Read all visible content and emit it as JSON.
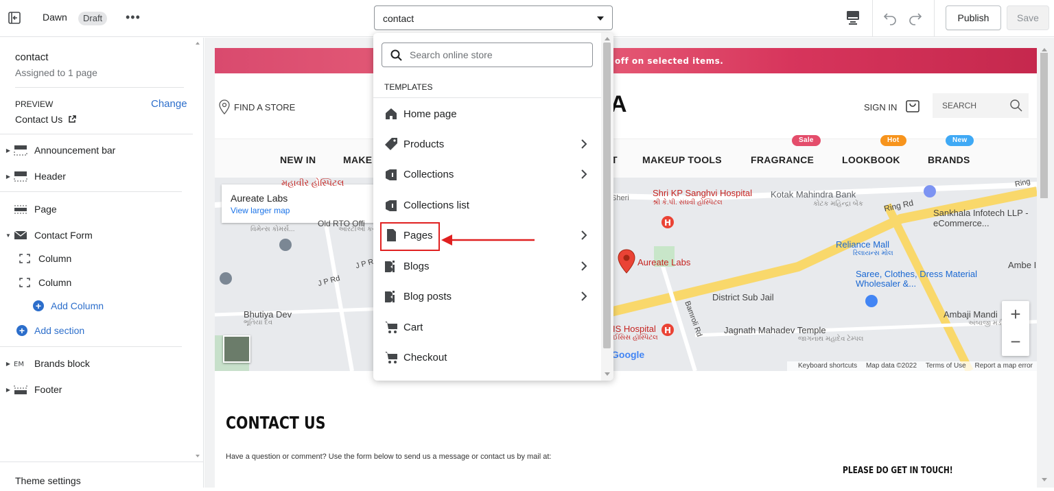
{
  "topbar": {
    "theme_name": "Dawn",
    "draft_label": "Draft",
    "more_label": "•••",
    "template_value": "contact",
    "publish_label": "Publish",
    "save_label": "Save"
  },
  "sidebar": {
    "title": "contact",
    "subtitle": "Assigned to 1 page",
    "preview_label": "PREVIEW",
    "change_label": "Change",
    "preview_value": "Contact Us",
    "sections": [
      {
        "label": "Announcement bar",
        "icon": "announcement-bar-icon"
      },
      {
        "label": "Header",
        "icon": "header-icon"
      },
      {
        "label": "Page",
        "icon": "page-icon"
      },
      {
        "label": "Contact Form",
        "icon": "mail-icon"
      },
      {
        "label": "Column",
        "icon": "column-icon"
      },
      {
        "label": "Column",
        "icon": "column-icon"
      },
      {
        "label": "Add Column",
        "icon": "plus-circle-icon"
      },
      {
        "label": "Add section",
        "icon": "plus-circle-icon"
      },
      {
        "label": "Brands block",
        "icon": "brands-block-icon"
      },
      {
        "label": "Footer",
        "icon": "footer-icon"
      }
    ],
    "theme_settings": "Theme settings"
  },
  "preview": {
    "announcement": "off on selected items.",
    "find_store": "FIND A STORE",
    "logo_fragment": "A",
    "sign_in": "SIGN IN",
    "search": "SEARCH",
    "nav": [
      {
        "label": "NEW IN"
      },
      {
        "label": "MAKE"
      },
      {
        "label": "T"
      },
      {
        "label": "MAKEUP TOOLS"
      },
      {
        "label": "FRAGRANCE",
        "badge": "Sale",
        "badge_color": "#e44d6b"
      },
      {
        "label": "LOOKBOOK",
        "badge": "Hot",
        "badge_color": "#f7941d"
      },
      {
        "label": "BRANDS",
        "badge": "New",
        "badge_color": "#3fa9f5"
      }
    ],
    "map": {
      "card_title": "Aureate Labs",
      "card_link": "View larger map",
      "labels": {
        "hospital": "Shri KP Sanghvi Hospital",
        "hospital_sub": "શ્રી કે.પી. સંઘવી હોસ્પિટલ",
        "kotak": "Kotak Mahindra Bank",
        "kotak_sub": "કોટક મહિન્દ્રા બેંક",
        "ring_rd": "Ring Rd",
        "ring": "Ring",
        "sankhala": "Sankhala Infotech LLP - eCommerce...",
        "reliance": "Reliance Mall",
        "reliance_sub": "રિલાયન્સ મોલ",
        "aureate": "Aureate Labs",
        "saree": "Saree, Clothes, Dress Material Wholesaler &...",
        "ambe": "Ambe I",
        "district": "District Sub Jail",
        "ambaji": "Ambaji Mandi",
        "ambaji_sub": "અંબાજી મંડી",
        "is_hospital": "IS Hospital",
        "is_hospital_sub": "ઈસિસ હૉસ્પિટલ",
        "bamroli": "Bamroli Rd",
        "jagnath": "Jagnath Mahadev Temple",
        "jagnath_sub": "જાગનાથ મહાદેવ ટેમ્પલ",
        "jp_rd": "J P Rd",
        "jp_rd2": "J P R",
        "bhutiya": "Bhutiya Dev",
        "bhutiya_sub": "ભૂતિયા દેવ",
        "mahavir": "મહાવીર હોસ્પિટલ",
        "sheri": "Sheri",
        "google": "Google",
        "old_rto": "Old RTO Offi",
        "vimens": "વિમેન્સ કોમર્સ...",
        "aarti": "આરટીઓ કચ"
      },
      "footer": [
        "Keyboard shortcuts",
        "Map data ©2022",
        "Terms of Use",
        "Report a map error"
      ]
    },
    "contact_heading": "CONTACT US",
    "contact_text": "Have a question or comment? Use the form below to send us a message or contact us by mail at:",
    "get_in_touch": "PLEASE DO GET IN TOUCH!"
  },
  "dropdown": {
    "search_placeholder": "Search online store",
    "section_label": "TEMPLATES",
    "items": [
      {
        "label": "Home page",
        "icon": "home-icon",
        "chevron": false
      },
      {
        "label": "Products",
        "icon": "tag-icon",
        "chevron": true
      },
      {
        "label": "Collections",
        "icon": "collection-icon",
        "chevron": true
      },
      {
        "label": "Collections list",
        "icon": "collection-icon",
        "chevron": false
      },
      {
        "label": "Pages",
        "icon": "page-icon",
        "chevron": true
      },
      {
        "label": "Blogs",
        "icon": "blog-icon",
        "chevron": true
      },
      {
        "label": "Blog posts",
        "icon": "blog-icon",
        "chevron": true
      },
      {
        "label": "Cart",
        "icon": "cart-icon",
        "chevron": false
      },
      {
        "label": "Checkout",
        "icon": "cart-icon",
        "chevron": false
      }
    ]
  },
  "colors": {
    "accent": "#2c6ecb",
    "annotation": "#e02020",
    "announcement": "#d94a6e"
  }
}
